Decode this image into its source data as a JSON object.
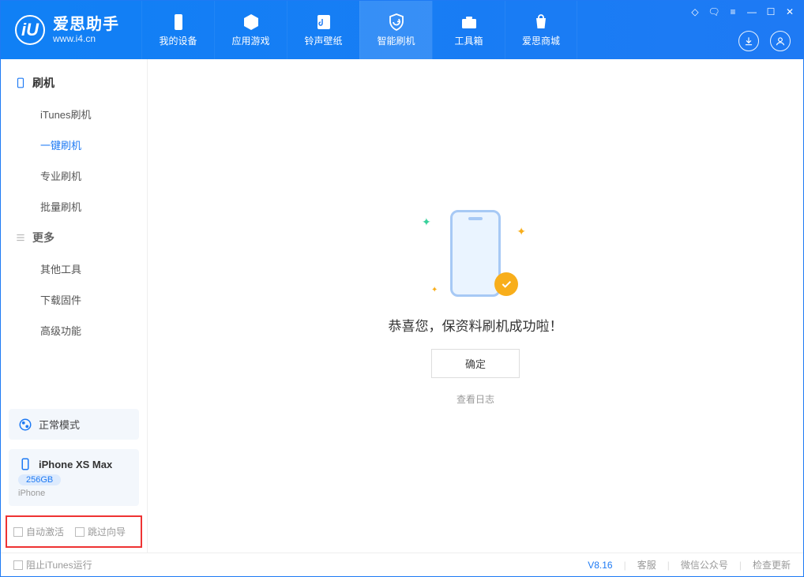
{
  "app": {
    "name": "爱思助手",
    "url": "www.i4.cn"
  },
  "tabs": [
    {
      "label": "我的设备"
    },
    {
      "label": "应用游戏"
    },
    {
      "label": "铃声壁纸"
    },
    {
      "label": "智能刷机",
      "active": true
    },
    {
      "label": "工具箱"
    },
    {
      "label": "爱思商城"
    }
  ],
  "sidebar": {
    "group1": {
      "title": "刷机",
      "items": [
        "iTunes刷机",
        "一键刷机",
        "专业刷机",
        "批量刷机"
      ],
      "active_index": 1
    },
    "group2": {
      "title": "更多",
      "items": [
        "其他工具",
        "下载固件",
        "高级功能"
      ]
    },
    "mode": "正常模式",
    "device": {
      "name": "iPhone XS Max",
      "storage": "256GB",
      "type": "iPhone"
    },
    "options": {
      "opt1": "自动激活",
      "opt2": "跳过向导"
    }
  },
  "main": {
    "success_text": "恭喜您，保资料刷机成功啦！",
    "ok_button": "确定",
    "log_link": "查看日志"
  },
  "footer": {
    "stop_itunes": "阻止iTunes运行",
    "version": "V8.16",
    "links": [
      "客服",
      "微信公众号",
      "检查更新"
    ]
  }
}
